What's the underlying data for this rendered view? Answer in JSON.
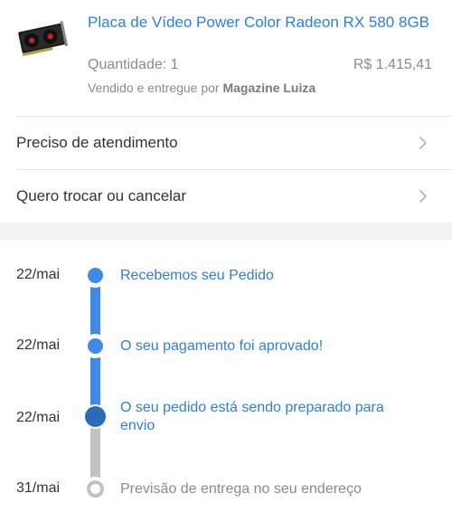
{
  "product": {
    "title": "Placa de Vídeo Power Color Radeon RX 580 8GB",
    "quantity": "Quantidade: 1",
    "price": "R$ 1.415,41",
    "sold_prefix": "Vendido e entregue por ",
    "seller": "Magazine Luiza",
    "image_icon": "graphics-card-image"
  },
  "menu": {
    "items": [
      {
        "label": "Preciso de atendimento"
      },
      {
        "label": "Quero trocar ou cancelar"
      }
    ]
  },
  "timeline": {
    "steps": [
      {
        "date": "22/mai",
        "text": "Recebemos seu Pedido",
        "status": "done"
      },
      {
        "date": "22/mai",
        "text": "O seu pagamento foi aprovado!",
        "status": "done"
      },
      {
        "date": "22/mai",
        "text": "O seu pedido está sendo preparado para envio",
        "status": "current"
      },
      {
        "date": "31/mai",
        "text": "Previsão de entrega no seu endereço",
        "status": "pending"
      }
    ]
  },
  "colors": {
    "accent": "#2d7fe0",
    "timeline_active": "#3f8ae6",
    "timeline_current": "#2d6bb8",
    "timeline_pending": "#c2c2c2"
  }
}
